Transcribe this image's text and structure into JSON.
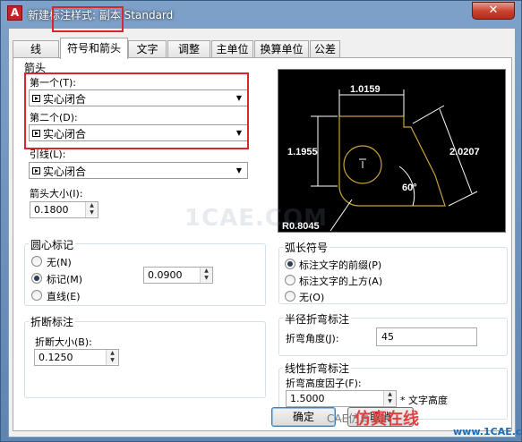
{
  "window": {
    "title": "新建标注样式: 副本 Standard",
    "app_icon": "A",
    "close_label": "✕"
  },
  "tabs": [
    "线",
    "符号和箭头",
    "文字",
    "调整",
    "主单位",
    "换算单位",
    "公差"
  ],
  "arrows": {
    "group_title": "箭头",
    "first_label": "第一个(T):",
    "first_value": "实心闭合",
    "second_label": "第二个(D):",
    "second_value": "实心闭合",
    "leader_label": "引线(L):",
    "leader_value": "实心闭合",
    "size_label": "箭头大小(I):",
    "size_value": "0.1800"
  },
  "center_marks": {
    "group_title": "圆心标记",
    "options": [
      "无(N)",
      "标记(M)",
      "直线(E)"
    ],
    "selected": "标记(M)",
    "value": "0.0900"
  },
  "break": {
    "group_title": "折断标注",
    "size_label": "折断大小(B):",
    "size_value": "0.1250"
  },
  "preview": {
    "dim_top": "1.0159",
    "dim_left": "1.1955",
    "dim_right": "2.0207",
    "angle": "60°",
    "radius": "R0.8045"
  },
  "arc_length": {
    "group_title": "弧长符号",
    "options": [
      "标注文字的前缀(P)",
      "标注文字的上方(A)",
      "无(O)"
    ],
    "selected": "标注文字的前缀(P)"
  },
  "radius_jog": {
    "group_title": "半径折弯标注",
    "angle_label": "折弯角度(J):",
    "angle_value": "45"
  },
  "linear_jog": {
    "group_title": "线性折弯标注",
    "factor_label": "折弯高度因子(F):",
    "factor_value": "1.5000",
    "unit_text": "* 文字高度"
  },
  "buttons": {
    "ok": "确定",
    "cancel": "取消"
  },
  "watermarks": {
    "center": "1CAE.COM",
    "footer_cn": "仿真在线",
    "footer_site": "www.1CAE.com",
    "footer_small": "CAE仿真"
  },
  "colors": {
    "highlight": "#d8262d",
    "preview_bg": "#000000",
    "preview_geometry": "#c8a33a",
    "preview_dim": "#ffffff"
  }
}
